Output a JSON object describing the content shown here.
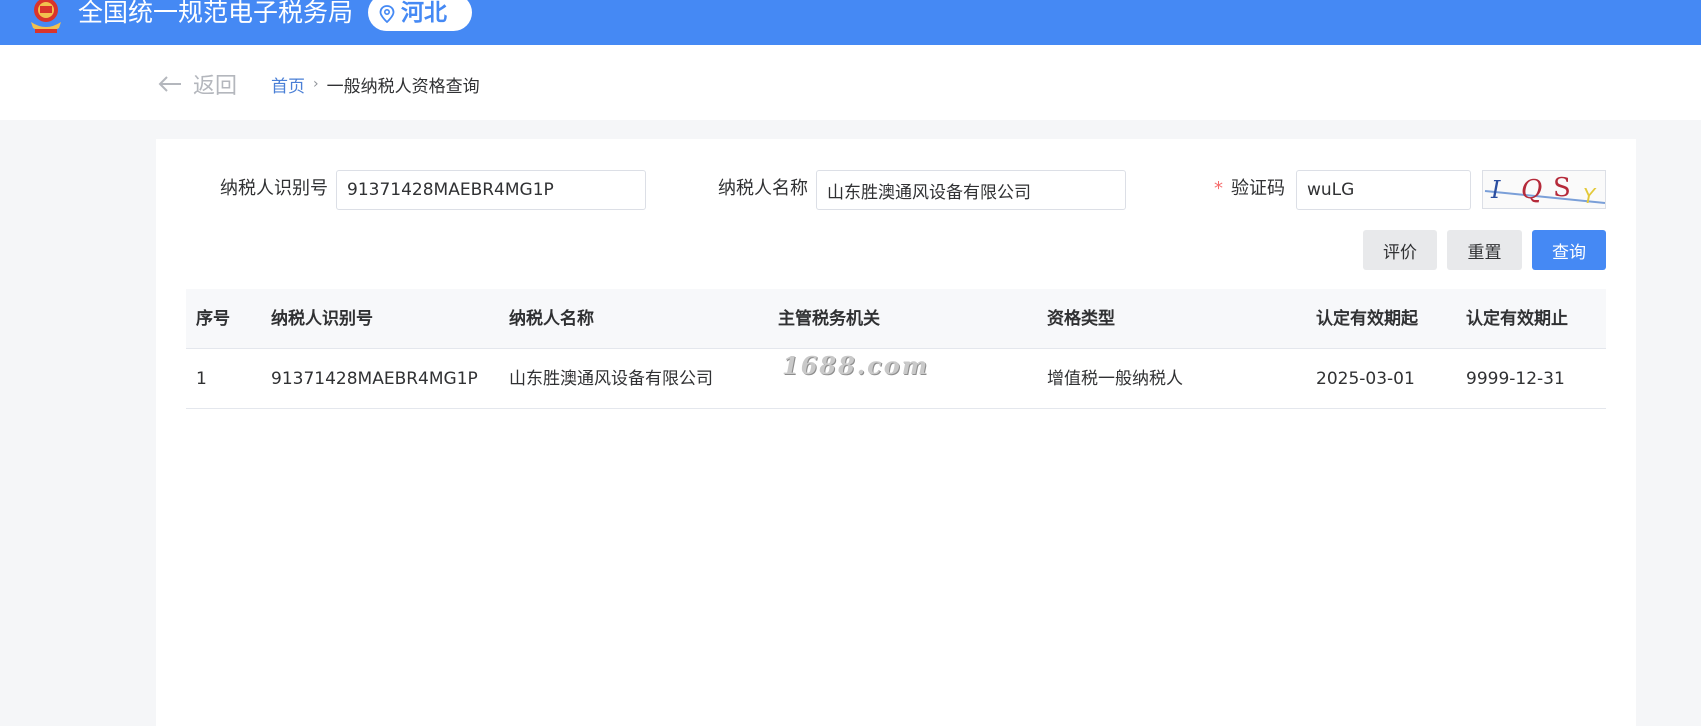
{
  "header": {
    "title": "全国统一规范电子税务局",
    "region": "河北",
    "brand_color": "#4589f4"
  },
  "nav": {
    "back_label": "返回",
    "breadcrumb_home": "首页",
    "breadcrumb_separator": "›",
    "breadcrumb_current": "一般纳税人资格查询"
  },
  "form": {
    "taxpayer_id_label": "纳税人识别号",
    "taxpayer_id_value": "91371428MAEBR4MG1P",
    "taxpayer_name_label": "纳税人名称",
    "taxpayer_name_value": "山东胜澳通风设备有限公司",
    "captcha_required_mark": "*",
    "captcha_label": "验证码",
    "captcha_value": "wuLG",
    "captcha_image_text": "IQSY"
  },
  "buttons": {
    "evaluate": "评价",
    "reset": "重置",
    "query": "查询"
  },
  "table": {
    "columns": [
      "序号",
      "纳税人识别号",
      "纳税人名称",
      "主管税务机关",
      "资格类型",
      "认定有效期起",
      "认定有效期止"
    ],
    "rows": [
      [
        "1",
        "91371428MAEBR4MG1P",
        "山东胜澳通风设备有限公司",
        "",
        "增值税一般纳税人",
        "2025-03-01",
        "9999-12-31"
      ]
    ]
  },
  "watermark": "1688.com"
}
